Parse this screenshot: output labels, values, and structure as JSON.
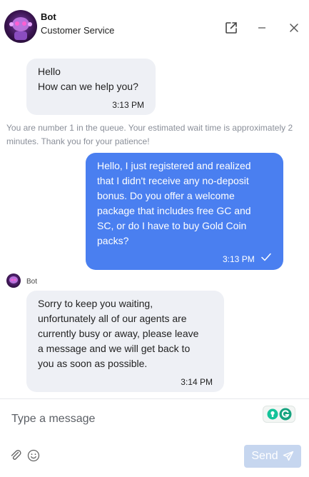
{
  "header": {
    "bot_name": "Bot",
    "subtitle": "Customer Service"
  },
  "messages": [
    {
      "from": "bot",
      "lines": [
        "Hello",
        "How can we help you?"
      ],
      "time": "3:13 PM"
    },
    {
      "from": "user",
      "lines": [
        "Hello, I just registered and realized",
        "that I didn't receive any no-deposit",
        "bonus. Do you offer a welcome",
        "package that includes free GC and",
        "SC, or do I have to buy Gold Coin",
        "packs?"
      ],
      "time": "3:13 PM",
      "status_icon": "check-icon"
    },
    {
      "from": "bot",
      "sender": "Bot",
      "lines": [
        "Sorry to keep you waiting,",
        "unfortunately all of our agents are",
        "currently busy or away, please leave",
        "a message and we will get back to",
        "you as soon as possible."
      ],
      "time": "3:14 PM"
    }
  ],
  "queue_notice": "You are number 1 in the queue. Your estimated wait time is approximately 2 minutes. Thank you for your patience!",
  "composer": {
    "placeholder": "Type a message",
    "send_label": "Send"
  },
  "colors": {
    "user_bubble": "#4a7ff0",
    "bot_bubble": "#eef0f5",
    "send_disabled": "#c6d6ef",
    "muted_text": "#8a8f99"
  }
}
